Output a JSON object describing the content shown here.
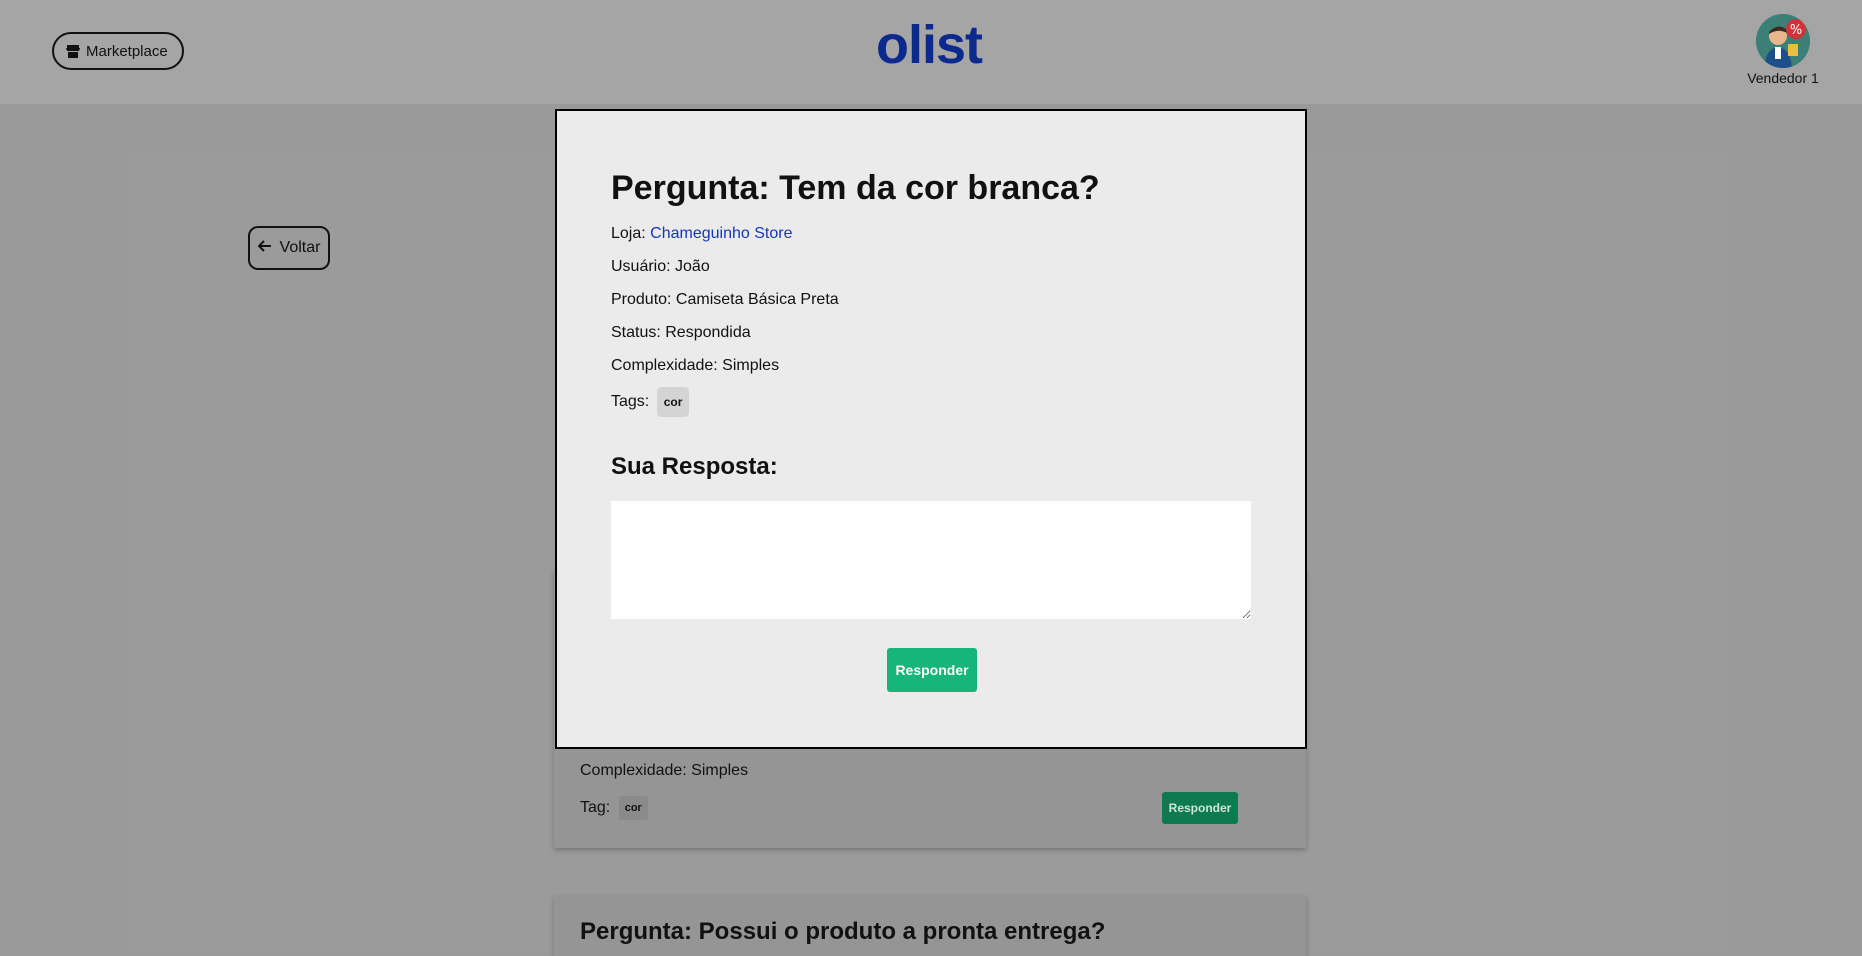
{
  "header": {
    "marketplace_label": "Marketplace",
    "logo_text": "olist",
    "user_name": "Vendedor 1"
  },
  "page": {
    "back_label": "Voltar"
  },
  "background_cards": [
    {
      "complexity": "Complexidade: Simples",
      "tag_label": "Tag:",
      "tag": "cor",
      "respond_label": "Responder"
    },
    {
      "title": "Pergunta: Possui o produto a pronta entrega?"
    }
  ],
  "modal": {
    "title": "Pergunta: Tem da cor branca?",
    "store_label": "Loja:",
    "store_name": "Chameguinho Store",
    "user_line": "Usuário: João",
    "product_line": "Produto: Camiseta Básica Preta",
    "status_line": "Status: Respondida",
    "complexity_line": "Complexidade: Simples",
    "tags_label": "Tags:",
    "tags": [
      "cor"
    ],
    "answer_title": "Sua Resposta:",
    "answer_value": "",
    "respond_label": "Responder"
  },
  "colors": {
    "brand": "#0c2a8d",
    "accent_green": "#16b57a",
    "link": "#1436b8"
  }
}
